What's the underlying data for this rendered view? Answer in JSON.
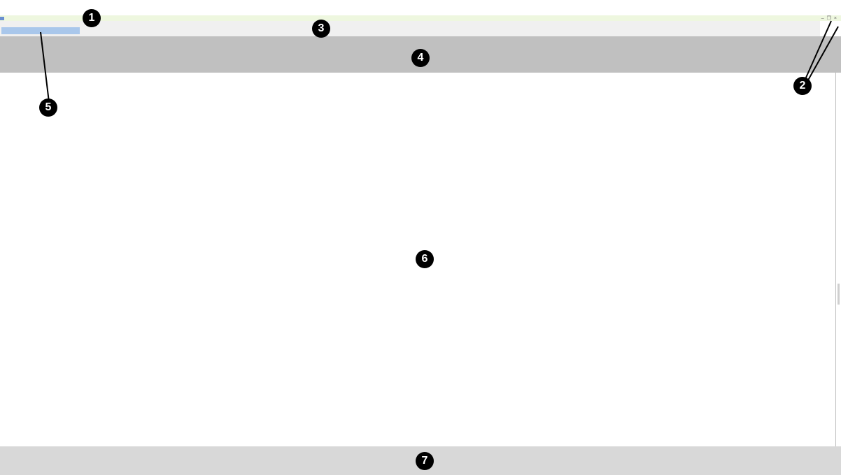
{
  "window": {
    "controls": {
      "minimize_glyph": "–",
      "restore_glyph": "❐",
      "close_glyph": "×"
    }
  },
  "colors": {
    "title_strip": "#eef7df",
    "tab_strip": "#f0f0f0",
    "active_tab": "#a9c7eb",
    "toolbar_band": "#c0c0c0",
    "content": "#ffffff",
    "status_bar": "#d8d8d8",
    "marker": "#000000"
  },
  "markers": [
    "1",
    "2",
    "3",
    "4",
    "5",
    "6",
    "7"
  ]
}
